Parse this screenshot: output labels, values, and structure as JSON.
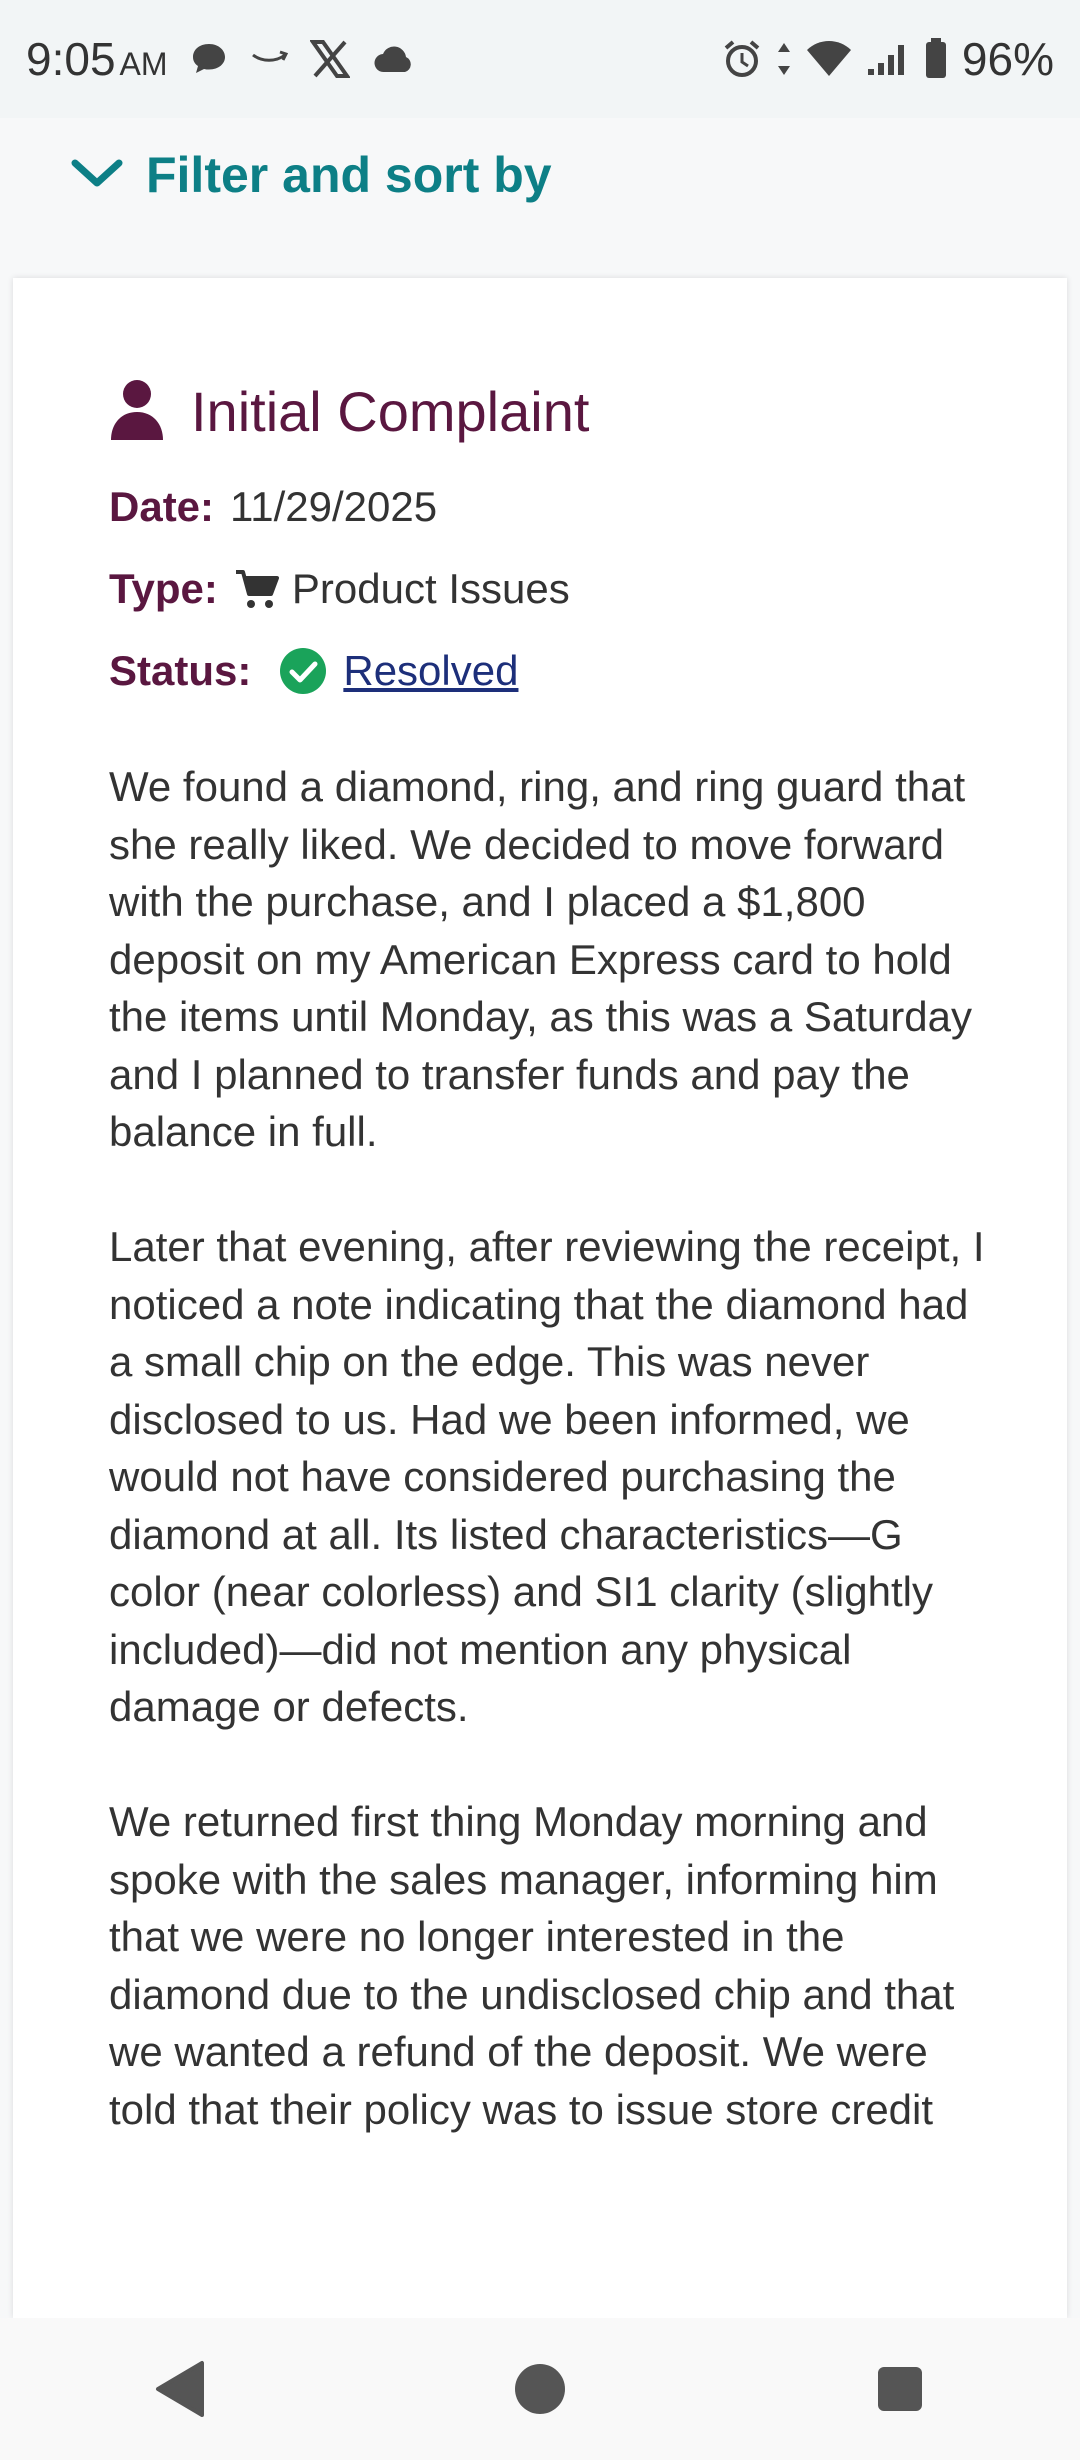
{
  "status_bar": {
    "time": "9:05",
    "ampm": "AM",
    "battery": "96%",
    "left_icons": [
      "chat-bubble-icon",
      "amazon-icon",
      "x-logo-icon",
      "cloud-icon"
    ],
    "right_icons": [
      "alarm-icon",
      "data-arrows-icon",
      "wifi-icon",
      "signal-icon",
      "battery-icon"
    ]
  },
  "filter": {
    "label": "Filter and sort by",
    "icon": "chevron-down-icon"
  },
  "complaint": {
    "title": "Initial Complaint",
    "title_icon": "person-icon",
    "date_label": "Date:",
    "date_value": "11/29/2025",
    "type_label": "Type:",
    "type_icon": "cart-icon",
    "type_value": "Product Issues",
    "status_label": "Status:",
    "status_icon": "check-circle-icon",
    "status_value": "Resolved",
    "paragraphs": [
      "We found a diamond, ring, and ring guard that she really liked. We decided to move forward with the purchase, and I placed a $1,800 deposit on my American Express card to hold the items until Monday, as this was a Saturday and I planned to transfer funds and pay the balance in full.",
      "Later that evening, after reviewing the receipt, I noticed a note indicating that the diamond had a small chip on the edge. This was never disclosed to us. Had we been informed, we would not have considered purchasing the diamond at all. Its listed characteristics—G color (near colorless) and SI1 clarity (slightly included)—did not mention any physical damage or defects.",
      "We returned first thing Monday morning and spoke with the sales manager, informing him that we were no longer interested in the diamond due to the undisclosed chip and that we wanted a refund of the deposit. We were told that their policy was to issue store credit"
    ]
  },
  "colors": {
    "accent_teal": "#0d7f86",
    "title_plum": "#5a1740",
    "link_navy": "#1d2f7a",
    "success_green": "#1aa35a"
  },
  "nav": {
    "icons": [
      "back-triangle-icon",
      "home-circle-icon",
      "recents-square-icon"
    ]
  }
}
